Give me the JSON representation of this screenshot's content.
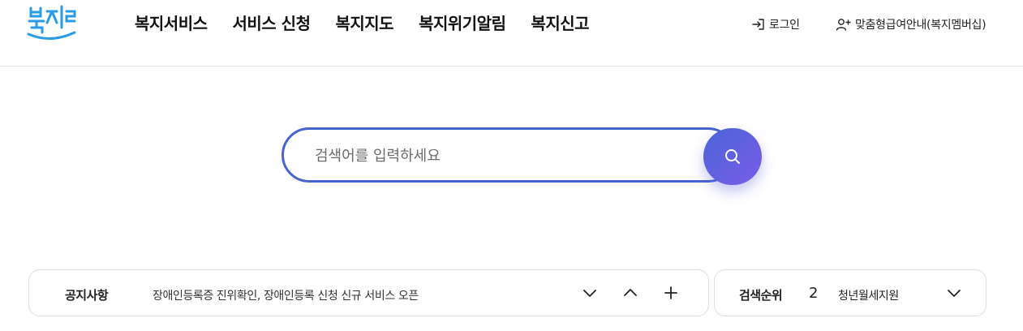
{
  "header": {
    "logo_text": "복지로",
    "nav": [
      "복지서비스",
      "서비스 신청",
      "복지지도",
      "복지위기알림",
      "복지신고"
    ],
    "login_label": "로그인",
    "member_label": "맞춤형급여안내(복지멤버십)"
  },
  "search": {
    "placeholder": "검색어를 입력하세요"
  },
  "notice": {
    "title": "공지사항",
    "text": "장애인등록증 진위확인, 장애인등록 신청 신규 서비스 오픈"
  },
  "ranking": {
    "title": "검색순위",
    "rank": "2",
    "term": "청년월세지원"
  },
  "icons": {
    "login": "login-icon",
    "member": "user-plus-icon",
    "search": "search-icon",
    "next": "chevron-down-icon",
    "prev": "chevron-up-icon",
    "more": "plus-icon",
    "toggle": "chevron-down-icon"
  },
  "colors": {
    "accent_blue": "#4763d0",
    "accent_purple": "#7a5ce8",
    "logo_blue": "#2a9be6"
  }
}
